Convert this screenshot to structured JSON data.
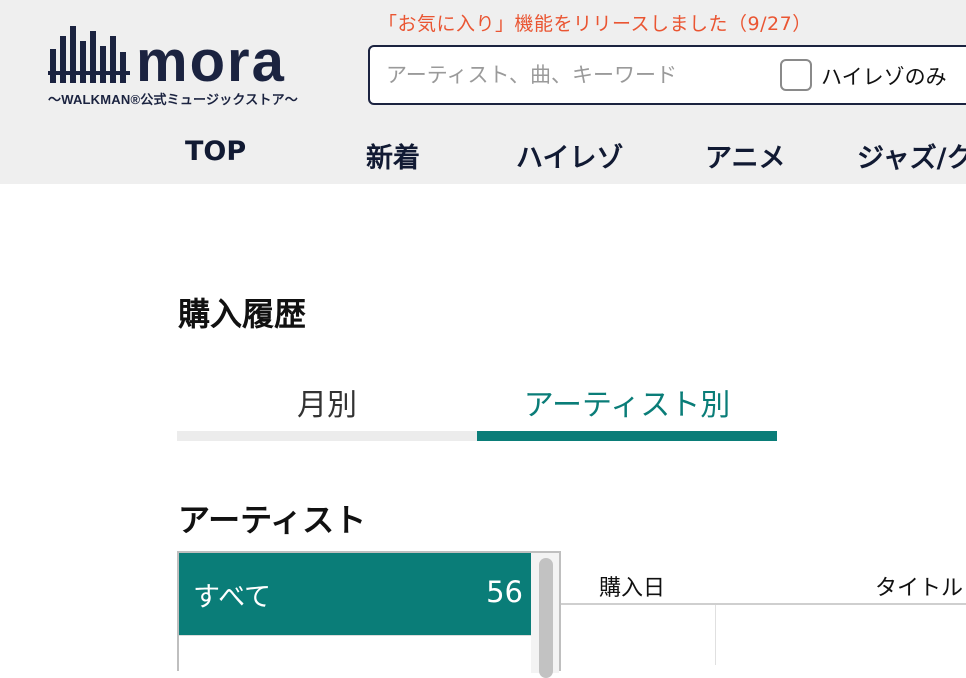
{
  "header": {
    "logo": {
      "text": "mora",
      "tagline": "〜WALKMAN®公式ミュージックストア〜"
    },
    "announcement": "「お気に入り」機能をリリースしました（9/27）",
    "search": {
      "placeholder": "アーティスト、曲、キーワード",
      "value": "",
      "hires_only_label": "ハイレゾのみ",
      "hires_only_checked": false
    },
    "nav": [
      {
        "label": "TOP"
      },
      {
        "label": "新着"
      },
      {
        "label": "ハイレゾ"
      },
      {
        "label": "アニメ"
      },
      {
        "label": "ジャズ/ク"
      }
    ]
  },
  "main": {
    "page_title": "購入履歴",
    "tabs": [
      {
        "label": "月別",
        "active": false
      },
      {
        "label": "アーティスト別",
        "active": true
      }
    ],
    "artist_section_title": "アーティスト",
    "artist_list": [
      {
        "name": "すべて",
        "count": "56",
        "selected": true
      }
    ],
    "table_headers": [
      "購入日",
      "タイトル"
    ]
  },
  "colors": {
    "accent": "#0a7d78",
    "announcement": "#ea5532",
    "header_bg": "#efefef",
    "brand_navy": "#1b2340"
  }
}
